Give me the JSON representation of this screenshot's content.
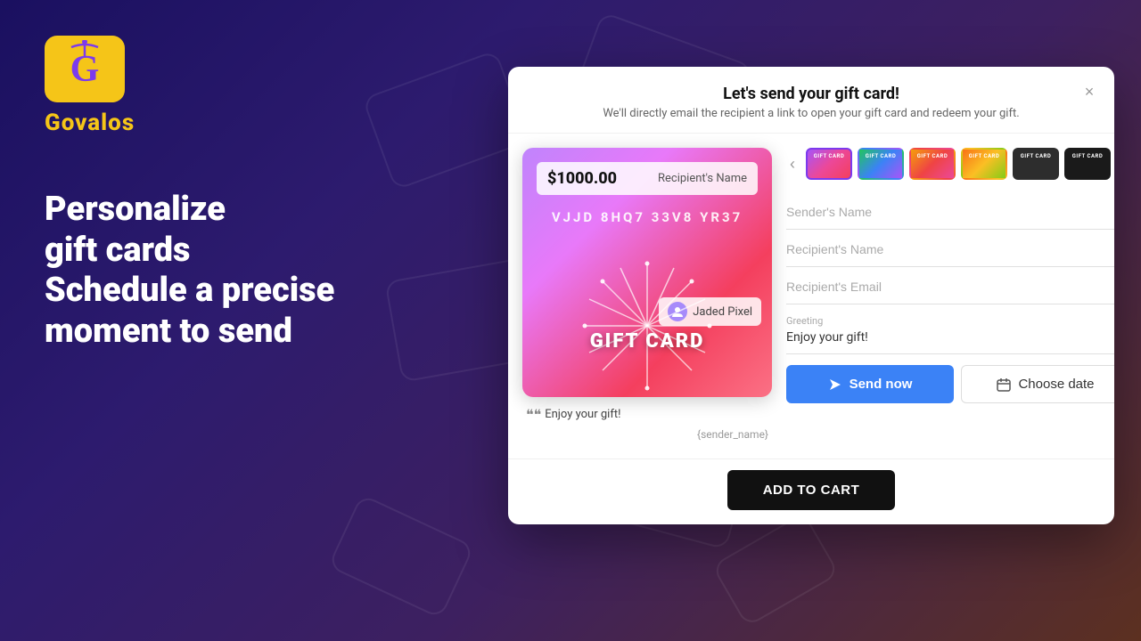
{
  "background": {
    "color_from": "#1a1060",
    "color_to": "#5c3020"
  },
  "logo": {
    "text": "Govalos",
    "letter": "G"
  },
  "tagline": {
    "line1": "Personalize",
    "line2": "gift cards",
    "line3": "Schedule a precise",
    "line4": "moment to send"
  },
  "modal": {
    "title": "Let's send your gift card!",
    "subtitle": "We'll directly email the recipient a link to open your gift card and redeem your gift.",
    "close_label": "×"
  },
  "card": {
    "amount": "$1000.00",
    "recipient_name_placeholder": "Recipient's Name",
    "code": "VJJD  8HQ7  33V8  YR37",
    "user_name": "Jaded Pixel",
    "label": "GIFT CARD",
    "greeting_prefix": "❝❝",
    "greeting_text": "Enjoy your gift!",
    "sender_placeholder": "{sender_name}"
  },
  "thumbnails": [
    {
      "id": "thumb-1",
      "label": "GIFT CARD",
      "active": true
    },
    {
      "id": "thumb-2",
      "label": "GIFT CARD",
      "active": false
    },
    {
      "id": "thumb-3",
      "label": "GIFT CARD",
      "active": false
    },
    {
      "id": "thumb-4",
      "label": "GIFT CARD",
      "active": false
    },
    {
      "id": "thumb-5",
      "label": "GIFT CARD",
      "active": false
    },
    {
      "id": "thumb-6",
      "label": "GIFT CARD",
      "active": false
    }
  ],
  "form": {
    "sender_name_placeholder": "Sender's Name",
    "recipient_name_placeholder": "Recipient's Name",
    "recipient_email_placeholder": "Recipient's Email",
    "greeting_label": "Greeting",
    "greeting_value": "Enjoy your gift!"
  },
  "buttons": {
    "send_now": "Send now",
    "choose_date": "Choose date",
    "add_to_cart": "ADD TO CART"
  },
  "nav": {
    "prev_label": "‹",
    "next_label": "›"
  }
}
